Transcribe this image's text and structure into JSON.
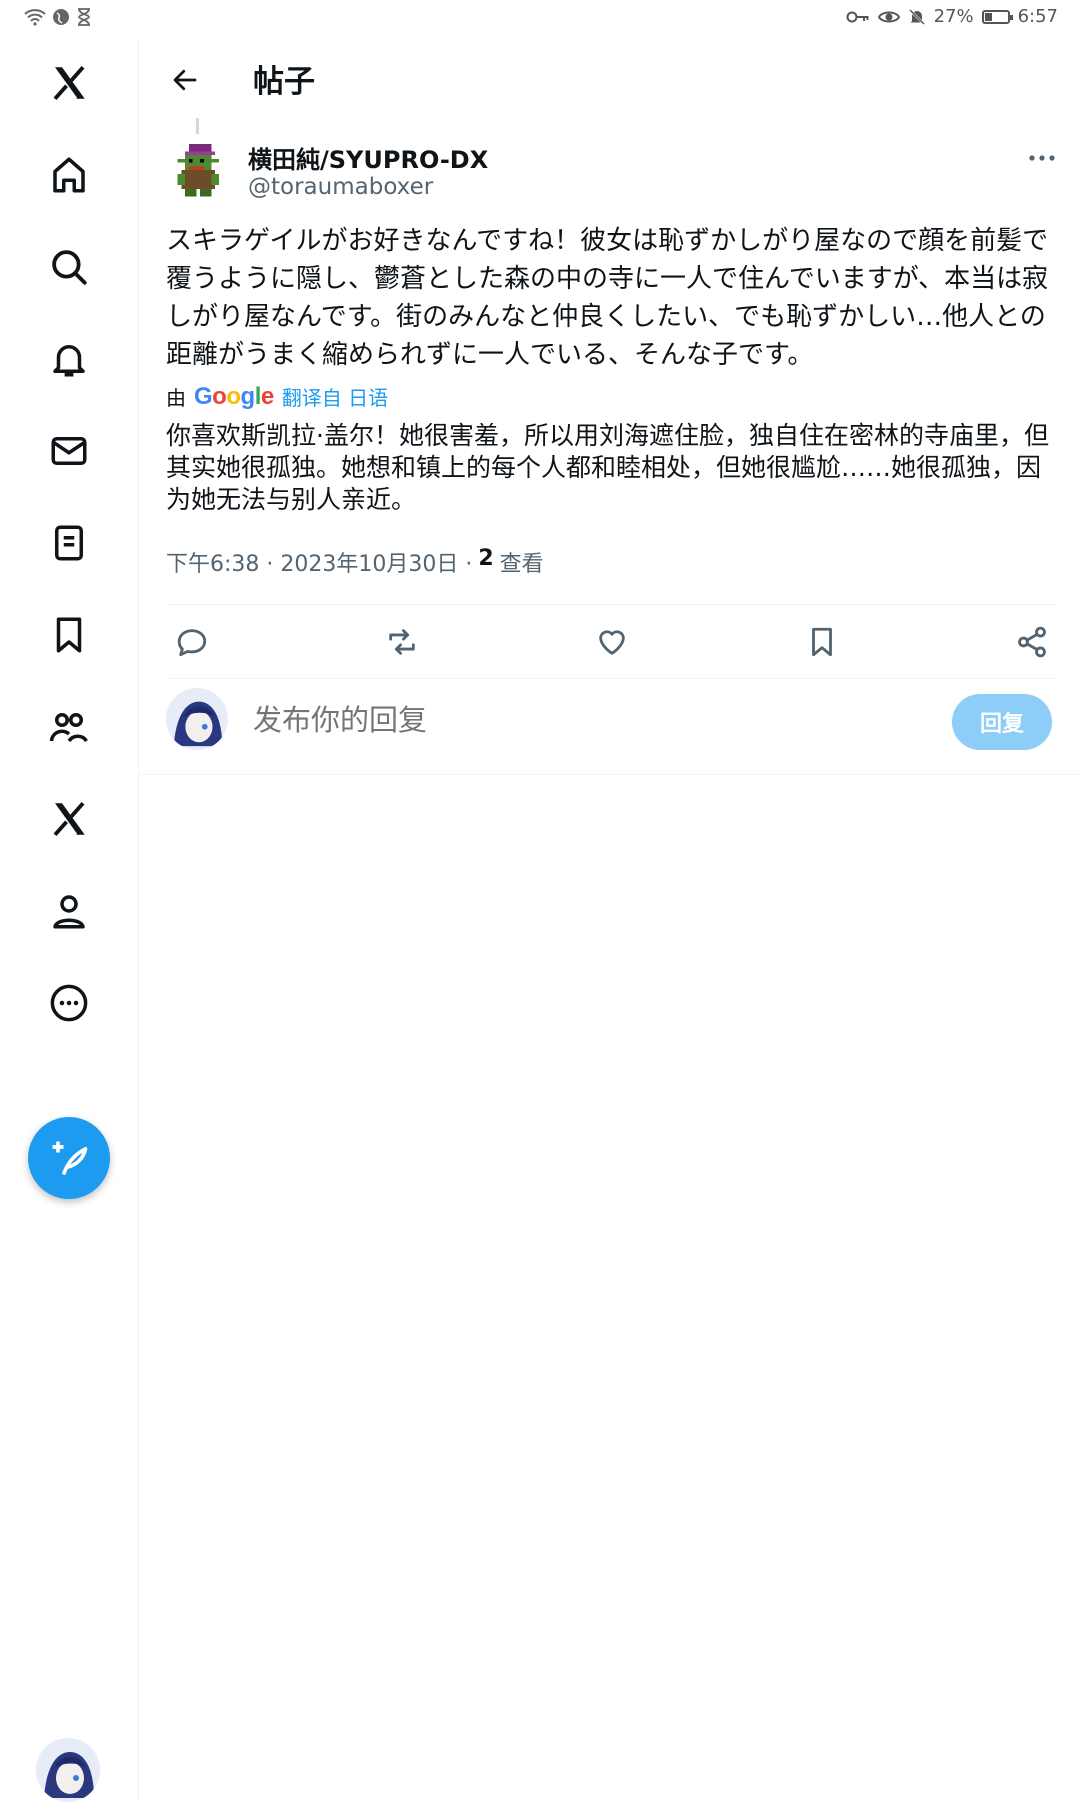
{
  "status_bar": {
    "battery": "27%",
    "time": "6:57",
    "battery_level": 0.27
  },
  "sidebar": {
    "items": [
      {
        "icon": "x-logo-icon"
      },
      {
        "icon": "home-icon"
      },
      {
        "icon": "search-icon"
      },
      {
        "icon": "bell-icon"
      },
      {
        "icon": "mail-icon"
      },
      {
        "icon": "list-icon"
      },
      {
        "icon": "bookmark-icon"
      },
      {
        "icon": "communities-icon"
      },
      {
        "icon": "x-premium-icon"
      },
      {
        "icon": "profile-icon"
      },
      {
        "icon": "more-icon"
      }
    ],
    "compose_icon": "compose-feather-icon"
  },
  "header": {
    "title": "帖子"
  },
  "post": {
    "author_name": "横田純/SYUPRO-DX",
    "author_handle": "@toraumaboxer",
    "original_text": "スキラゲイルがお好きなんですね！彼女は恥ずかしがり屋なので顔を前髪で覆うように隠し、鬱蒼とした森の中の寺に一人で住んでいますが、本当は寂しがり屋なんです。街のみんなと仲良くしたい、でも恥ずかしい…他人との距離がうまく縮められずに一人でいる、そんな子です。",
    "translate_by": "由",
    "translate_brand": "Google",
    "translate_link": "翻译自 日语",
    "translated_text": "你喜欢斯凯拉·盖尔！她很害羞，所以用刘海遮住脸，独自住在密林的寺庙里，但其实她很孤独。她想和镇上的每个人都和睦相处，但她很尴尬……她很孤独，因为她无法与别人亲近。",
    "timestamp": "下午6:38 · 2023年10月30日 ·",
    "views_count": "2",
    "views_label": "查看"
  },
  "reply": {
    "placeholder": "发布你的回复",
    "button_label": "回复"
  },
  "colors": {
    "accent": "#1d9bf0",
    "reply_button_disabled": "#8ecdf8",
    "secondary_text": "#536471"
  }
}
